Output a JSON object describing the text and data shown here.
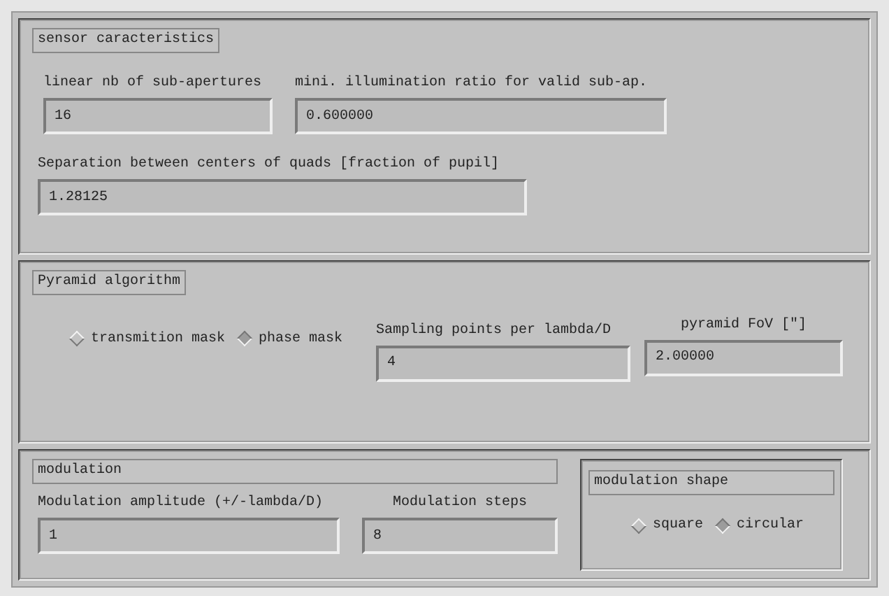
{
  "sensor": {
    "title": "sensor caracteristics",
    "fields": [
      {
        "label": "linear nb of sub-apertures",
        "value": "16"
      },
      {
        "label": "mini. illumination ratio for valid sub-ap.",
        "value": "0.600000"
      },
      {
        "label": "Separation between centers of quads [fraction of pupil]",
        "value": "1.28125"
      }
    ]
  },
  "pyramid": {
    "title": "Pyramid algorithm",
    "options": [
      {
        "label": "transmition mask",
        "selected": false
      },
      {
        "label": "phase mask",
        "selected": true
      }
    ],
    "fields": [
      {
        "label": "Sampling points per lambda/D",
        "value": "4"
      },
      {
        "label": "pyramid FoV [\"]",
        "value": "2.00000"
      }
    ]
  },
  "modulation": {
    "title": "modulation",
    "fields": [
      {
        "label": "Modulation amplitude (+/-lambda/D)",
        "value": "1"
      },
      {
        "label": "Modulation steps",
        "value": "8"
      }
    ],
    "shape": {
      "title": "modulation shape",
      "options": [
        {
          "label": "square",
          "selected": false
        },
        {
          "label": "circular",
          "selected": true
        }
      ]
    }
  }
}
